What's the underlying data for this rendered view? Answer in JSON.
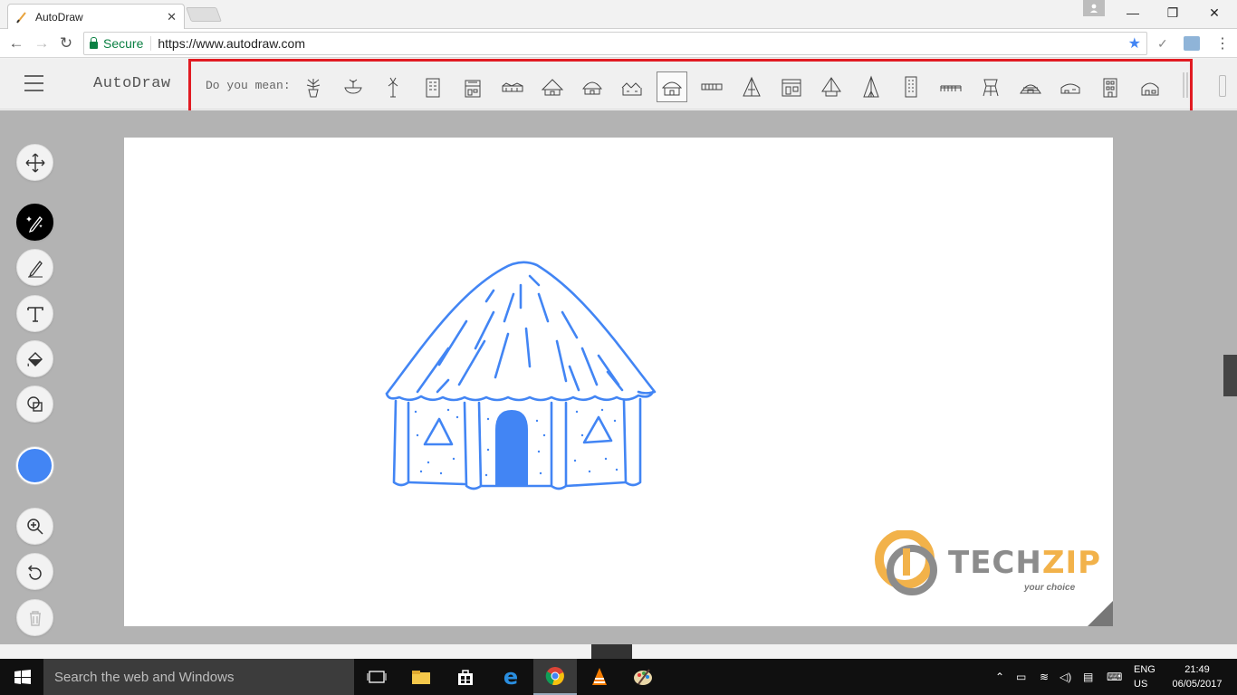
{
  "browser": {
    "tab_title": "AutoDraw",
    "secure_label": "Secure",
    "url": "https://www.autodraw.com"
  },
  "app": {
    "logo": "AutoDraw",
    "suggest_label": "Do you mean:",
    "suggestions": [
      "potted-plant",
      "plant-bowl",
      "palm-plant",
      "building",
      "tower",
      "house-row",
      "hut",
      "dome-hut",
      "village",
      "hut-selected",
      "fence",
      "tent-a",
      "store",
      "tent-pyramid",
      "teepee",
      "tall-building",
      "bridge",
      "water-tower",
      "igloo",
      "car-house",
      "apartment",
      "small-house"
    ],
    "tools": [
      "move-tool",
      "autodraw-tool",
      "draw-tool",
      "type-tool",
      "fill-tool",
      "shape-tool",
      "zoom-tool",
      "undo-tool",
      "delete-tool"
    ],
    "active_color": "#4285f4",
    "drawing_color": "#4285f4"
  },
  "watermark": {
    "brand1": "TECH",
    "brand2": "ZIP",
    "tagline": "your choice"
  },
  "taskbar": {
    "search_placeholder": "Search the web and Windows",
    "lang_top": "ENG",
    "lang_bottom": "US",
    "time": "21:49",
    "date": "06/05/2017"
  }
}
